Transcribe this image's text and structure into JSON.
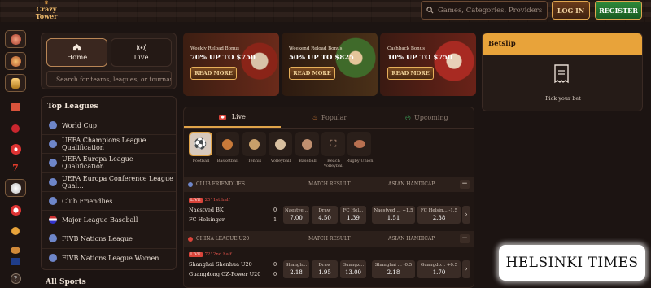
{
  "brand": {
    "logo_line1": "Crazy",
    "logo_line2": "Tower"
  },
  "header": {
    "search_placeholder": "Games, Categories, Providers",
    "login": "LOG IN",
    "register": "REGISTER"
  },
  "rail": {
    "icons": [
      "sports-ball-icon",
      "slots-icon",
      "trophy-icon",
      "gift-icon",
      "cherry-icon",
      "roulette-icon",
      "seven-icon",
      "football-icon",
      "live-casino-icon",
      "coins-icon",
      "flag-icon",
      "help-icon"
    ]
  },
  "nav": {
    "home": "Home",
    "live": "Live",
    "search_placeholder": "Search for teams, leagues, or tournaments"
  },
  "leagues": {
    "title": "Top Leagues",
    "items": [
      "World Cup",
      "UEFA Champions League Qualification",
      "UEFA Europa League Qualification",
      "UEFA Europa Conference League Qual...",
      "Club Friendlies",
      "Major League Baseball",
      "FIVB Nations League",
      "FIVB Nations League Women"
    ],
    "all_sports": "All Sports"
  },
  "banners": [
    {
      "kicker": "Weekly Reload Bonus",
      "headline": "70% UP TO $750",
      "cta": "READ MORE"
    },
    {
      "kicker": "Weekend Reload Bonus",
      "headline": "50% UP TO $825",
      "cta": "READ MORE"
    },
    {
      "kicker": "Cashback Bonus",
      "headline": "10% UP TO $750",
      "cta": "READ MORE"
    }
  ],
  "betslip": {
    "title": "Betslip",
    "empty": "Pick your bet"
  },
  "board": {
    "tabs": [
      "Live",
      "Popular",
      "Upcoming"
    ],
    "sports": [
      "Football",
      "Basketball",
      "Tennis",
      "Volleyball",
      "Baseball",
      "Beach Volleyball",
      "Rugby Union"
    ],
    "sections": [
      {
        "name": "CLUB FRIENDLIES",
        "col1": "MATCH RESULT",
        "col2": "ASIAN HANDICAP",
        "match": {
          "time": "25' 1st half",
          "home": "Naestved BK",
          "away": "FC Helsingør",
          "home_score": "0",
          "away_score": "1",
          "odds": [
            {
              "label": "Naestve...",
              "value": "7.00"
            },
            {
              "label": "Draw",
              "value": "4.50"
            },
            {
              "label": "FC Hel...",
              "value": "1.39"
            },
            {
              "label": "Naestved ... +1.5",
              "value": "1.51"
            },
            {
              "label": "FC Helsin... -1.5",
              "value": "2.38"
            }
          ]
        }
      },
      {
        "name": "CHINA LEAGUE U20",
        "col1": "MATCH RESULT",
        "col2": "ASIAN HANDICAP",
        "match": {
          "time": "72' 2nd half",
          "home": "Shanghai Shenhua U20",
          "away": "Guangdong GZ-Power U20",
          "home_score": "0",
          "away_score": "0",
          "odds": [
            {
              "label": "Shangh...",
              "value": "2.18"
            },
            {
              "label": "Draw",
              "value": "1.95"
            },
            {
              "label": "Guangz...",
              "value": "13.00"
            },
            {
              "label": "Shanghai ... -0.5",
              "value": "2.18"
            },
            {
              "label": "Guangdo... +0.5",
              "value": "1.70"
            }
          ]
        }
      }
    ]
  },
  "watermark": "HELSINKI TIMES",
  "colors": {
    "accent": "#e8a33a",
    "register": "#2e8a3a",
    "live": "#d9443a"
  }
}
